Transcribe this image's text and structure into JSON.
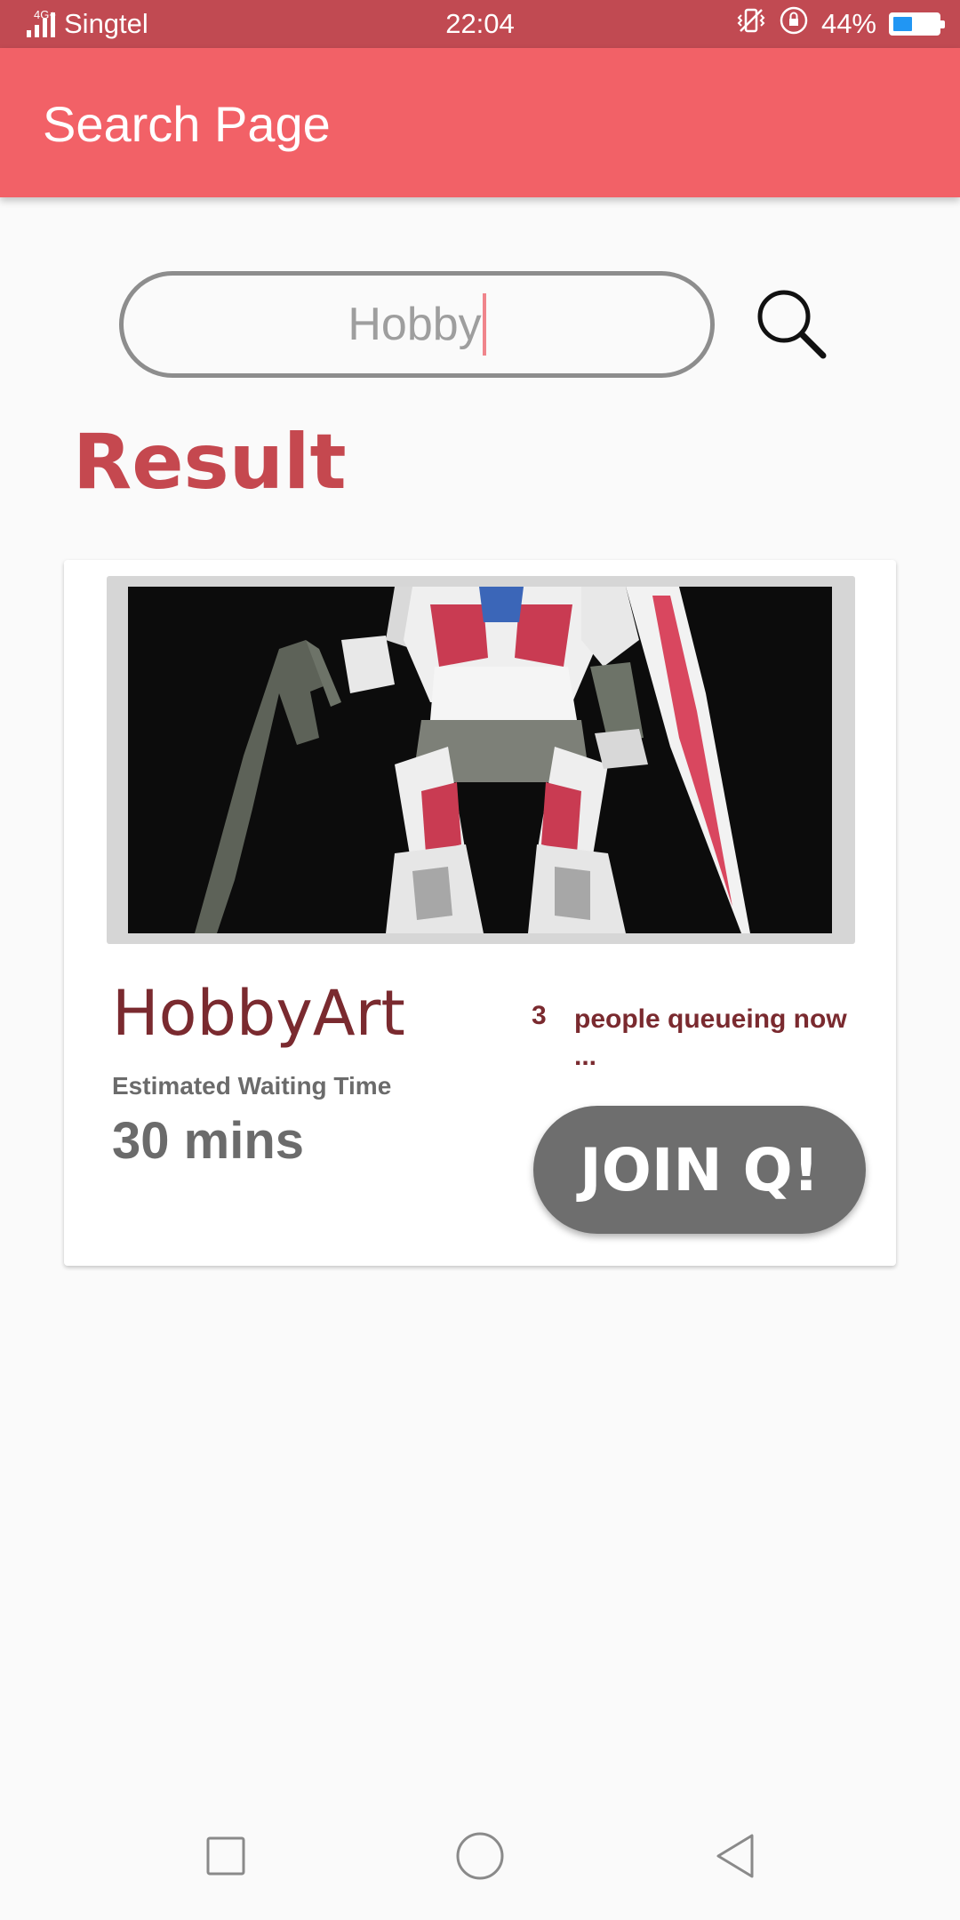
{
  "status_bar": {
    "network": "4G+",
    "carrier": "Singtel",
    "time": "22:04",
    "battery_percent": "44%",
    "battery_level": 0.44,
    "icons": [
      "vibrate-icon",
      "rotation-lock-icon",
      "battery-icon"
    ]
  },
  "app_bar": {
    "title": "Search Page"
  },
  "search": {
    "value": "Hobby",
    "icon": "search-icon"
  },
  "results": {
    "heading": "Result",
    "items": [
      {
        "name": "HobbyArt",
        "waiting_label": "Estimated Waiting Time",
        "waiting_time": "30 mins",
        "queue_count": "3",
        "queue_text": "people queueing now ...",
        "join_label": "JOIN Q!",
        "image": "gundam-robot-photo"
      }
    ]
  },
  "nav_bar": {
    "icons": [
      "recent-apps-icon",
      "home-icon",
      "back-icon"
    ]
  },
  "colors": {
    "status_bar": "#c14a52",
    "app_bar": "#f26167",
    "accent_red": "#c5484f",
    "shop_name": "#7a2a2f",
    "join_button": "#6e6e6e"
  }
}
